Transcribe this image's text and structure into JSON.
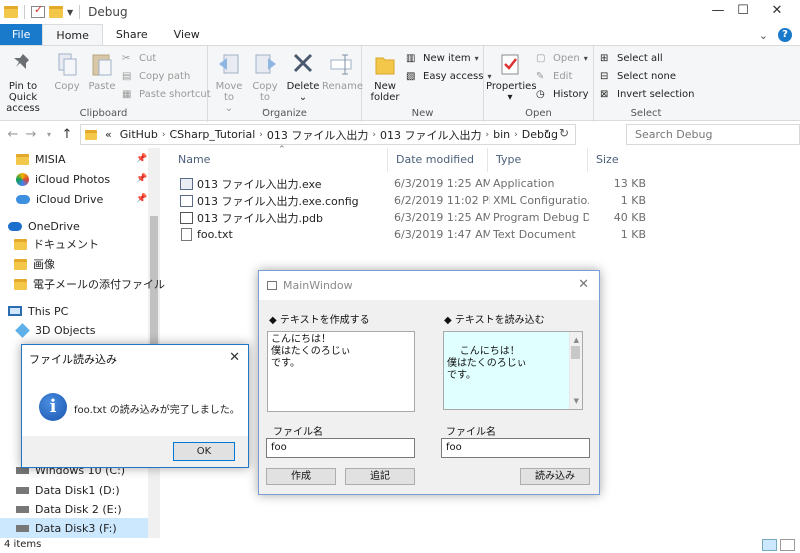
{
  "window": {
    "title": "Debug"
  },
  "tabs": [
    "File",
    "Home",
    "Share",
    "View"
  ],
  "ribbon": {
    "clipboard": {
      "label": "Clipboard",
      "pin": "Pin to Quick access",
      "copy": "Copy",
      "paste": "Paste",
      "cut": "Cut",
      "copy_path": "Copy path",
      "paste_shortcut": "Paste shortcut"
    },
    "organize": {
      "label": "Organize",
      "move_to": "Move to",
      "copy_to": "Copy to",
      "delete": "Delete",
      "rename": "Rename"
    },
    "new": {
      "label": "New",
      "new_folder": "New folder",
      "new_item": "New item",
      "easy_access": "Easy access"
    },
    "open": {
      "label": "Open",
      "properties": "Properties",
      "open": "Open",
      "edit": "Edit",
      "history": "History"
    },
    "select": {
      "label": "Select",
      "select_all": "Select all",
      "select_none": "Select none",
      "invert": "Invert selection"
    }
  },
  "address": {
    "prefix": "«",
    "crumbs": [
      "GitHub",
      "CSharp_Tutorial",
      "013 ファイル入出力",
      "013 ファイル入出力",
      "bin",
      "Debug"
    ]
  },
  "search": {
    "placeholder": "Search Debug"
  },
  "nav": {
    "quick": [
      "MISIA",
      "iCloud Photos",
      "iCloud Drive"
    ],
    "onedrive": "OneDrive",
    "onedrive_items": [
      "ドキュメント",
      "画像",
      "電子メールの添付ファイル"
    ],
    "thispc": "This PC",
    "objects3d": "3D Objects",
    "drives": [
      "Windows 10 (C:)",
      "Data Disk1 (D:)",
      "Data Disk 2 (E:)",
      "Data Disk3 (F:)"
    ]
  },
  "columns": {
    "name": "Name",
    "date": "Date modified",
    "type": "Type",
    "size": "Size"
  },
  "files": [
    {
      "name": "013 ファイル入出力.exe",
      "date": "6/3/2019 1:25 AM",
      "type": "Application",
      "size": "13 KB"
    },
    {
      "name": "013 ファイル入出力.exe.config",
      "date": "6/2/2019 11:02 PM",
      "type": "XML Configuratio...",
      "size": "1 KB"
    },
    {
      "name": "013 ファイル入出力.pdb",
      "date": "6/3/2019 1:25 AM",
      "type": "Program Debug D...",
      "size": "40 KB"
    },
    {
      "name": "foo.txt",
      "date": "6/3/2019 1:47 AM",
      "type": "Text Document",
      "size": "1 KB"
    }
  ],
  "status": {
    "count": "4 items"
  },
  "mainwindow": {
    "title": "MainWindow",
    "left_header": "◆ テキストを作成する",
    "right_header": "◆ テキストを読み込む",
    "left_text": "こんにちは！\n僕はたくのろじぃ\nです。",
    "right_text": "こんにちは！\n僕はたくのろじぃ\nです。",
    "file_label_left": "ファイル名",
    "file_label_right": "ファイル名",
    "file_value_left": "foo",
    "file_value_right": "foo",
    "btn_create": "作成",
    "btn_append": "追記",
    "btn_read": "読み込み"
  },
  "dialog": {
    "title": "ファイル読み込み",
    "message": "foo.txt の読み込みが完了しました。",
    "ok": "OK"
  },
  "colors": {
    "accent": "#1979ca",
    "selection": "#cce8ff",
    "textbox_read": "#e0ffff"
  }
}
